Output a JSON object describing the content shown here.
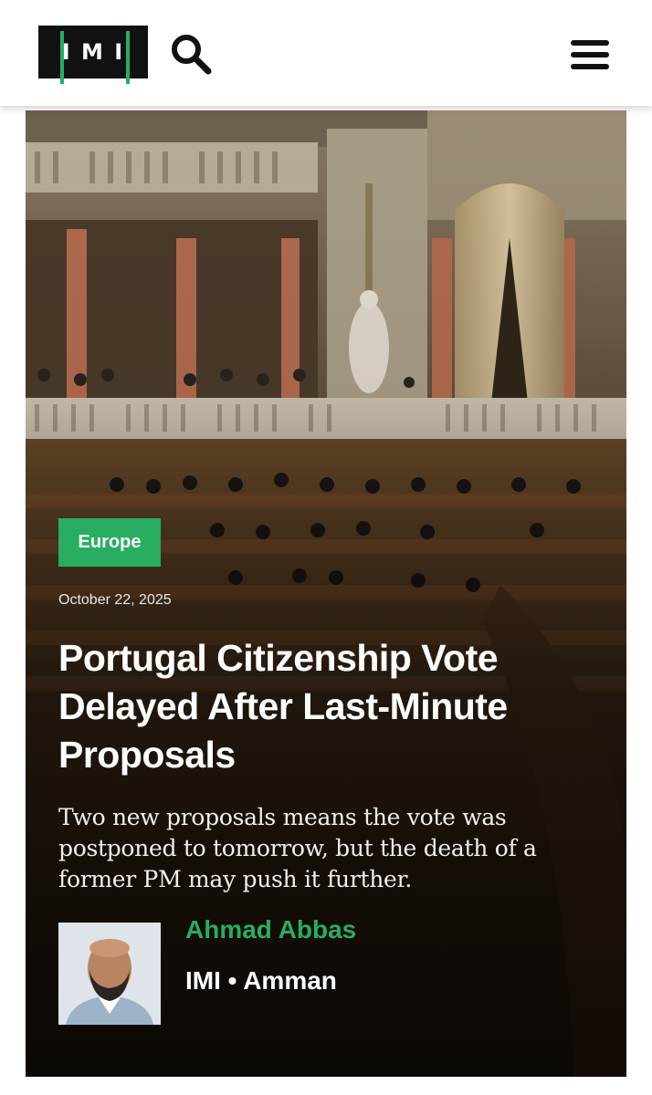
{
  "header": {
    "logo_text": "I M I",
    "search_icon": "search-icon",
    "menu_icon": "hamburger-menu-icon"
  },
  "colors": {
    "accent": "#27ae60",
    "logo_bg": "#111111",
    "header_bg": "#ffffff"
  },
  "article": {
    "category": "Europe",
    "date": "October 22, 2025",
    "title": "Portugal Citizenship Vote Delayed After Last-Minute Proposals",
    "excerpt": "Two new proposals means the vote was postponed to tomorrow, but the death of a former PM may push it further.",
    "author_name": "Ahmad Abbas",
    "author_meta": "IMI • Amman"
  }
}
